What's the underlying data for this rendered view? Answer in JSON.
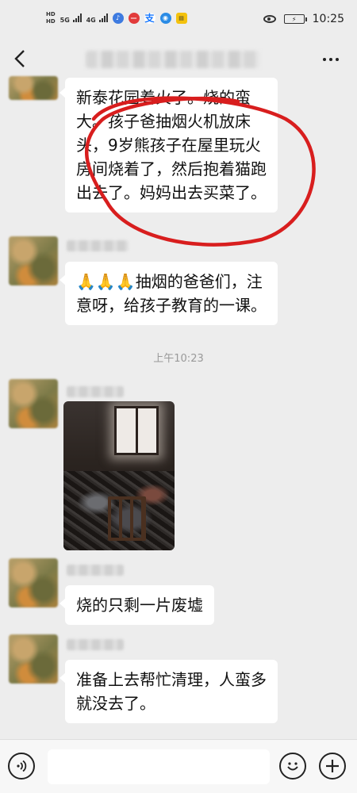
{
  "status_bar": {
    "hd1": "HD",
    "hd2": "HD",
    "sim1": "5G",
    "sim2": "4G",
    "time": "10:25",
    "icons": [
      "hd-icon",
      "signal-5g-icon",
      "signal-4g-icon",
      "music-app-icon",
      "red-app-icon",
      "alipay-icon",
      "blue-app-icon",
      "yellow-app-icon",
      "eye-icon",
      "battery-charging-icon"
    ]
  },
  "title_bar": {
    "back_icon": "chevron-left-icon",
    "more_icon": "more-dots-icon"
  },
  "messages": [
    {
      "type": "text",
      "lines": [
        "新泰花园着火了。烧的蛮",
        "大。孩子爸抽烟火机放床",
        "头，9岁熊孩子在屋里玩火",
        "房间烧着了，然后抱着猫跑",
        "出去了。妈妈出去买菜了。"
      ]
    },
    {
      "type": "text",
      "lines": [
        "🙏🙏🙏抽烟的爸爸们，注",
        "意呀，给孩子教育的一课。"
      ]
    },
    {
      "type": "timestamp",
      "text": "上午10:23"
    },
    {
      "type": "image",
      "description": "burned-room-photo"
    },
    {
      "type": "text",
      "lines": [
        "烧的只剩一片废墟"
      ]
    },
    {
      "type": "text",
      "lines": [
        "准备上去帮忙清理，人蛮多",
        "就没去了。"
      ]
    }
  ],
  "input_bar": {
    "placeholder": "",
    "voice_icon": "voice-icon",
    "emoji_icon": "emoji-icon",
    "plus_icon": "plus-icon"
  },
  "colors": {
    "background": "#ededed",
    "bubble": "#ffffff",
    "annotation_red": "#d81e1e"
  }
}
